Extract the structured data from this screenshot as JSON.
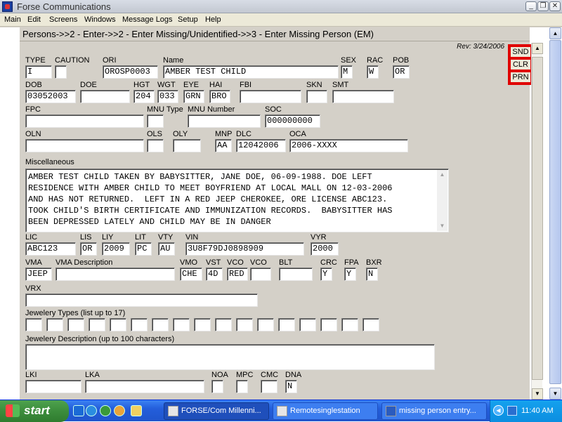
{
  "window": {
    "title": "Forse Communications",
    "controls": {
      "minimize": "_",
      "restore": "❐",
      "close": "✕"
    }
  },
  "menu": [
    "Main",
    "Edit",
    "Screens",
    "Windows",
    "Message Logs",
    "Setup",
    "Help"
  ],
  "breadcrumb": "Persons->>2 - Enter->>2 - Enter Missing/Unidentified->>3 - Enter Missing Person (EM)",
  "revision": "Rev: 3/24/2006",
  "side_buttons": {
    "send": "SND",
    "clear": "CLR",
    "print": "PRN"
  },
  "fields": {
    "type": {
      "label": "TYPE",
      "value": "I"
    },
    "caution": {
      "label": "CAUTION",
      "value": ""
    },
    "ori": {
      "label": "ORI",
      "value": "OROSP0003"
    },
    "name": {
      "label": "Name",
      "value": "AMBER TEST CHILD"
    },
    "sex": {
      "label": "SEX",
      "value": "M"
    },
    "rac": {
      "label": "RAC",
      "value": "W"
    },
    "pob": {
      "label": "POB",
      "value": "OR"
    },
    "dob": {
      "label": "DOB",
      "value": "03052003"
    },
    "doe": {
      "label": "DOE",
      "value": ""
    },
    "hgt": {
      "label": "HGT",
      "value": "204"
    },
    "wgt": {
      "label": "WGT",
      "value": "033"
    },
    "eye": {
      "label": "EYE",
      "value": "GRN"
    },
    "hai": {
      "label": "HAI",
      "value": "BRO"
    },
    "fbi": {
      "label": "FBI",
      "value": ""
    },
    "skn": {
      "label": "SKN",
      "value": ""
    },
    "smt": {
      "label": "SMT",
      "value": ""
    },
    "fpc": {
      "label": "FPC",
      "value": ""
    },
    "mnu_type": {
      "label": "MNU Type",
      "value": ""
    },
    "mnu_number": {
      "label": "MNU Number",
      "value": ""
    },
    "soc": {
      "label": "SOC",
      "value": "000000000"
    },
    "oln": {
      "label": "OLN",
      "value": ""
    },
    "ols": {
      "label": "OLS",
      "value": ""
    },
    "oly": {
      "label": "OLY",
      "value": ""
    },
    "mnp": {
      "label": "MNP",
      "value": "AA"
    },
    "dlc": {
      "label": "DLC",
      "value": "12042006"
    },
    "oca": {
      "label": "OCA",
      "value": "2006-XXXX"
    },
    "misc": {
      "label": "Miscellaneous",
      "lines": [
        "AMBER TEST CHILD TAKEN BY BABYSITTER, JANE DOE, 06-09-1988. DOE LEFT",
        "RESIDENCE WITH AMBER CHILD TO MEET BOYFRIEND AT LOCAL MALL ON 12-03-2006",
        "AND HAS NOT RETURNED.  LEFT IN A RED JEEP CHEROKEE, ORE LICENSE ABC123.",
        "TOOK CHILD'S BIRTH CERTIFICATE AND IMMUNIZATION RECORDS.  BABYSITTER HAS",
        "BEEN DEPRESSED LATELY AND CHILD MAY BE IN DANGER"
      ]
    },
    "lic": {
      "label": "LIC",
      "value": "ABC123"
    },
    "lis": {
      "label": "LIS",
      "value": "OR"
    },
    "liy": {
      "label": "LIY",
      "value": "2009"
    },
    "lit": {
      "label": "LIT",
      "value": "PC"
    },
    "vty": {
      "label": "VTY",
      "value": "AU"
    },
    "vin": {
      "label": "VIN",
      "value": "3U8F79DJ0898909"
    },
    "vyr": {
      "label": "VYR",
      "value": "2000"
    },
    "vma": {
      "label": "VMA",
      "value": "JEEP"
    },
    "vma_desc": {
      "label": "VMA Description",
      "value": ""
    },
    "vmo": {
      "label": "VMO",
      "value": "CHE"
    },
    "vst": {
      "label": "VST",
      "value": "4D"
    },
    "vco": {
      "label": "VCO",
      "value": "RED"
    },
    "vco2": {
      "label": "VCO",
      "value": ""
    },
    "blt": {
      "label": "BLT",
      "value": ""
    },
    "crc": {
      "label": "CRC",
      "value": "Y"
    },
    "fpa": {
      "label": "FPA",
      "value": "Y"
    },
    "bxr": {
      "label": "BXR",
      "value": "N"
    },
    "vrx": {
      "label": "VRX",
      "value": ""
    },
    "jewelry_types": {
      "label": "Jewelery Types (list up to 17)",
      "values": [
        "",
        "",
        "",
        "",
        "",
        "",
        "",
        "",
        "",
        "",
        "",
        "",
        "",
        "",
        "",
        "",
        ""
      ]
    },
    "jewelry_desc": {
      "label": "Jewelery Description (up to 100 characters)",
      "value": ""
    },
    "lki": {
      "label": "LKI",
      "value": ""
    },
    "lka": {
      "label": "LKA",
      "value": ""
    },
    "noa": {
      "label": "NOA",
      "value": ""
    },
    "mpc": {
      "label": "MPC",
      "value": ""
    },
    "cmc": {
      "label": "CMC",
      "value": ""
    },
    "dna": {
      "label": "DNA",
      "value": "N"
    }
  },
  "taskbar": {
    "start_label": "start",
    "tasks": [
      {
        "label": "FORSE/Com Millenni...",
        "active": true
      },
      {
        "label": "Remotesinglestation",
        "active": false
      },
      {
        "label": "missing person entry...",
        "active": false
      }
    ],
    "clock": "11:40 AM"
  },
  "colors": {
    "form_bg": "#d4d0c8",
    "highlight_border": "#e00000",
    "taskbar": "#245edb",
    "start": "#3c8d3c"
  }
}
